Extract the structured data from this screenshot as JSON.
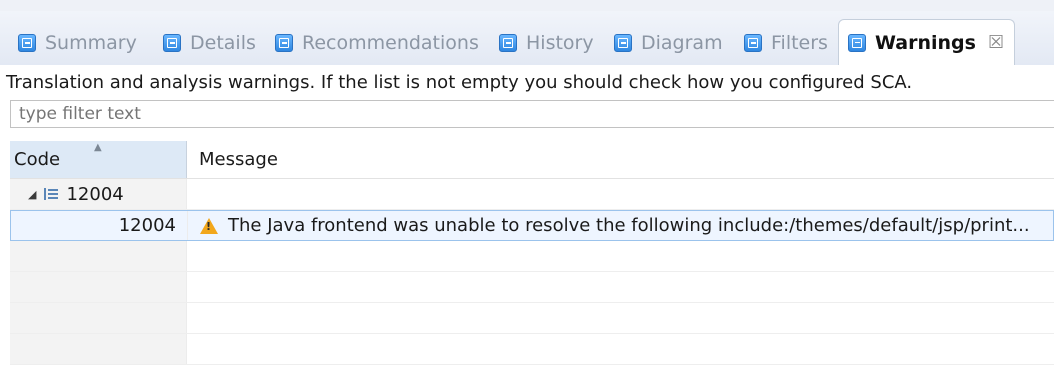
{
  "tabs": [
    {
      "label": "Summary",
      "icon": "view-icon",
      "active": false
    },
    {
      "label": "Details",
      "icon": "view-icon",
      "active": false
    },
    {
      "label": "Recommendations",
      "icon": "view-icon",
      "active": false
    },
    {
      "label": "History",
      "icon": "view-icon",
      "active": false
    },
    {
      "label": "Diagram",
      "icon": "view-icon",
      "active": false
    },
    {
      "label": "Filters",
      "icon": "view-icon",
      "active": false
    },
    {
      "label": "Warnings",
      "icon": "view-icon",
      "active": true,
      "close": "☒"
    }
  ],
  "description": "Translation and analysis warnings. If the list is not empty you should check how you configured SCA.",
  "filter": {
    "placeholder": "type filter text",
    "value": ""
  },
  "table": {
    "columns": {
      "code": "Code",
      "message": "Message"
    },
    "groups": [
      {
        "code": "12004",
        "expanded": true,
        "rows": [
          {
            "code": "12004",
            "severity": "warning-icon",
            "message": "The Java frontend was unable to resolve the following include:/themes/default/jsp/print..."
          }
        ]
      }
    ]
  },
  "colors": {
    "accent": "#2f86e0",
    "selection": "#eef5ff",
    "warning": "#f2a71b",
    "header": "#dde9f6"
  }
}
